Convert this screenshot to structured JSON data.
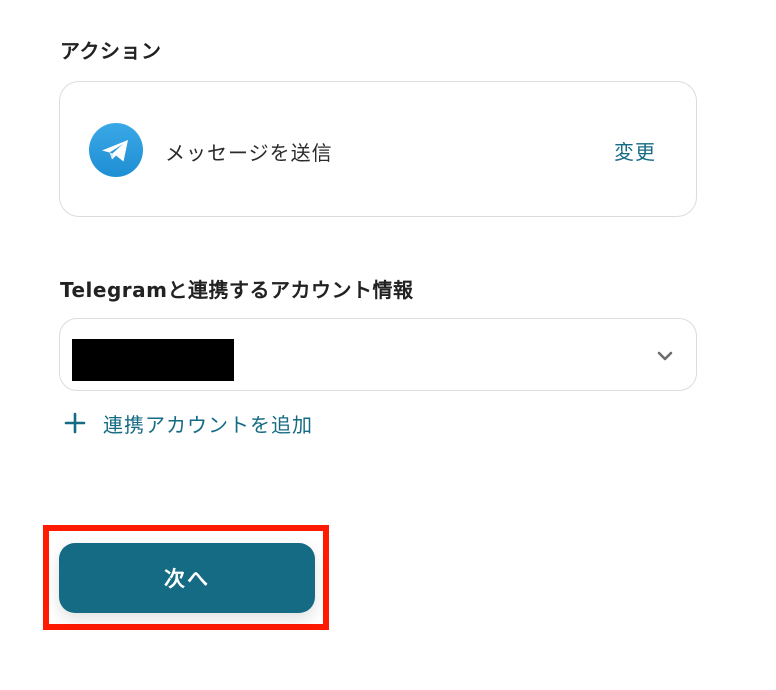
{
  "action_section": {
    "label": "アクション",
    "action": {
      "icon": "telegram-icon",
      "name": "メッセージを送信",
      "change_label": "変更"
    }
  },
  "account_section": {
    "label": "Telegramと連携するアカウント情報",
    "select": {
      "selected_value": "",
      "redacted": true,
      "icon": "chevron-down-icon"
    },
    "add_account": {
      "icon": "plus-icon",
      "label": "連携アカウントを追加"
    }
  },
  "footer": {
    "next_label": "次へ",
    "highlight_color": "#ff1a00"
  },
  "colors": {
    "accent": "#166b84",
    "telegram_blue": "#2aa0e0",
    "border": "#d9dde0"
  }
}
